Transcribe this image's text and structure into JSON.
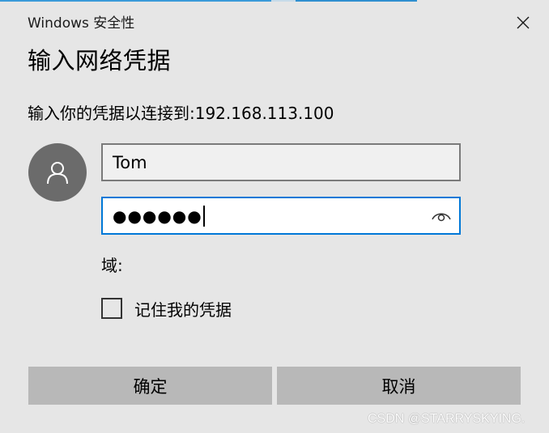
{
  "window": {
    "title": "Windows 安全性",
    "close_icon": "close-icon",
    "accent_color": "#0078d7"
  },
  "dialog": {
    "heading": "输入网络凭据",
    "subtitle": "输入你的凭据以连接到:192.168.113.100"
  },
  "credentials": {
    "avatar_icon": "user-icon",
    "username": "Tom",
    "password_mask": "●●●●●●",
    "reveal_icon": "eye-icon",
    "domain_label": "域:"
  },
  "remember": {
    "label": "记住我的凭据",
    "checked": false
  },
  "buttons": {
    "ok": "确定",
    "cancel": "取消"
  },
  "watermark": "CSDN @STARRYSKYING."
}
